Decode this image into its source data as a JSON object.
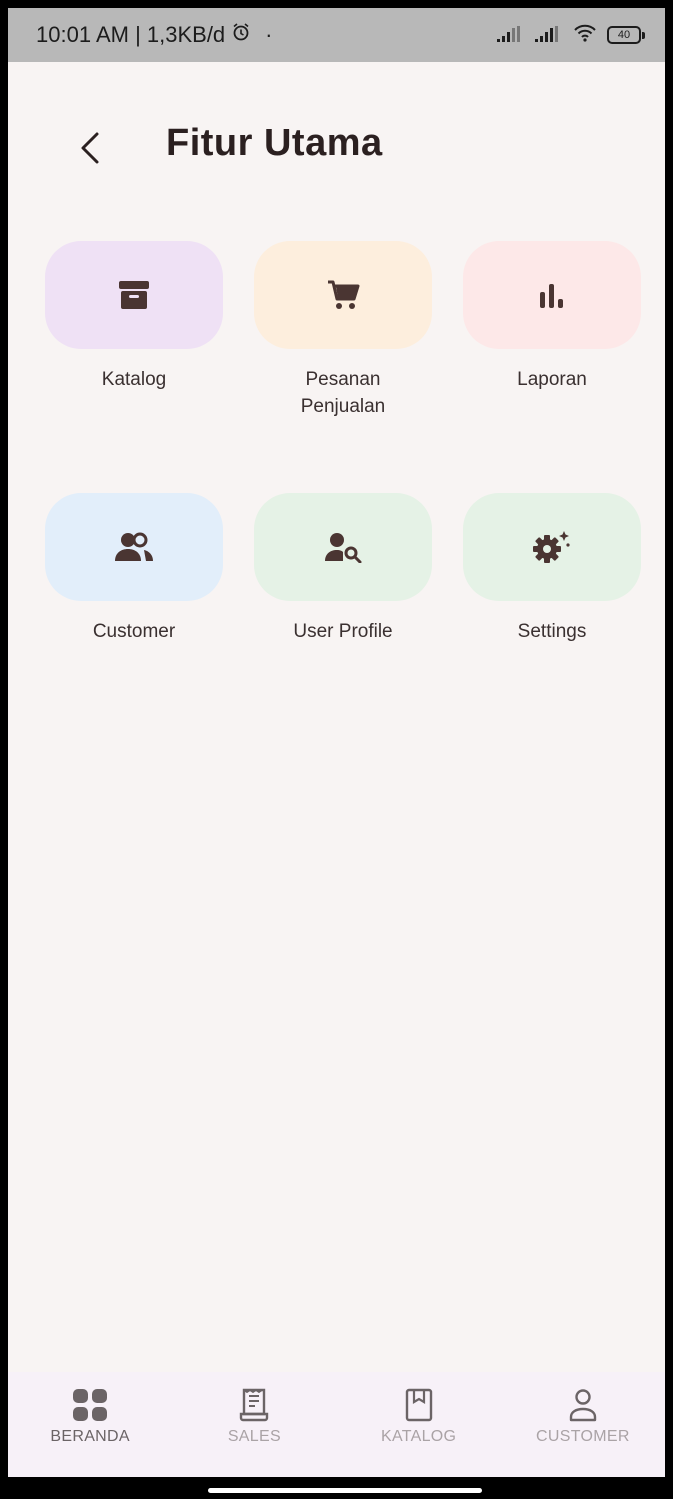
{
  "status_bar": {
    "time_info": "10:01 AM | 1,3KB/d",
    "dot": "·",
    "battery_level": "40"
  },
  "header": {
    "title": "Fitur Utama",
    "back_icon": "chevron-left-icon"
  },
  "features": [
    {
      "label": "Katalog",
      "icon": "archive-box-icon",
      "bg": "#efe1f5"
    },
    {
      "label": "Pesanan\nPenjualan",
      "icon": "shopping-cart-icon",
      "bg": "#fdeedd"
    },
    {
      "label": "Laporan",
      "icon": "bar-chart-icon",
      "bg": "#fde8e8"
    },
    {
      "label": "Customer",
      "icon": "people-icon",
      "bg": "#e2eefa"
    },
    {
      "label": "User Profile",
      "icon": "person-search-icon",
      "bg": "#e5f2e6"
    },
    {
      "label": "Settings",
      "icon": "gear-sparkle-icon",
      "bg": "#e5f2e6"
    }
  ],
  "bottom_nav": [
    {
      "label": "BERANDA",
      "icon": "grid-icon",
      "active": true
    },
    {
      "label": "SALES",
      "icon": "receipt-icon",
      "active": false
    },
    {
      "label": "KATALOG",
      "icon": "book-icon",
      "active": false
    },
    {
      "label": "CUSTOMER",
      "icon": "person-outline-icon",
      "active": false
    }
  ],
  "colors": {
    "icon_brown": "#4a3532",
    "background": "#f8f4f3",
    "nav_background": "#f7f1f8"
  }
}
